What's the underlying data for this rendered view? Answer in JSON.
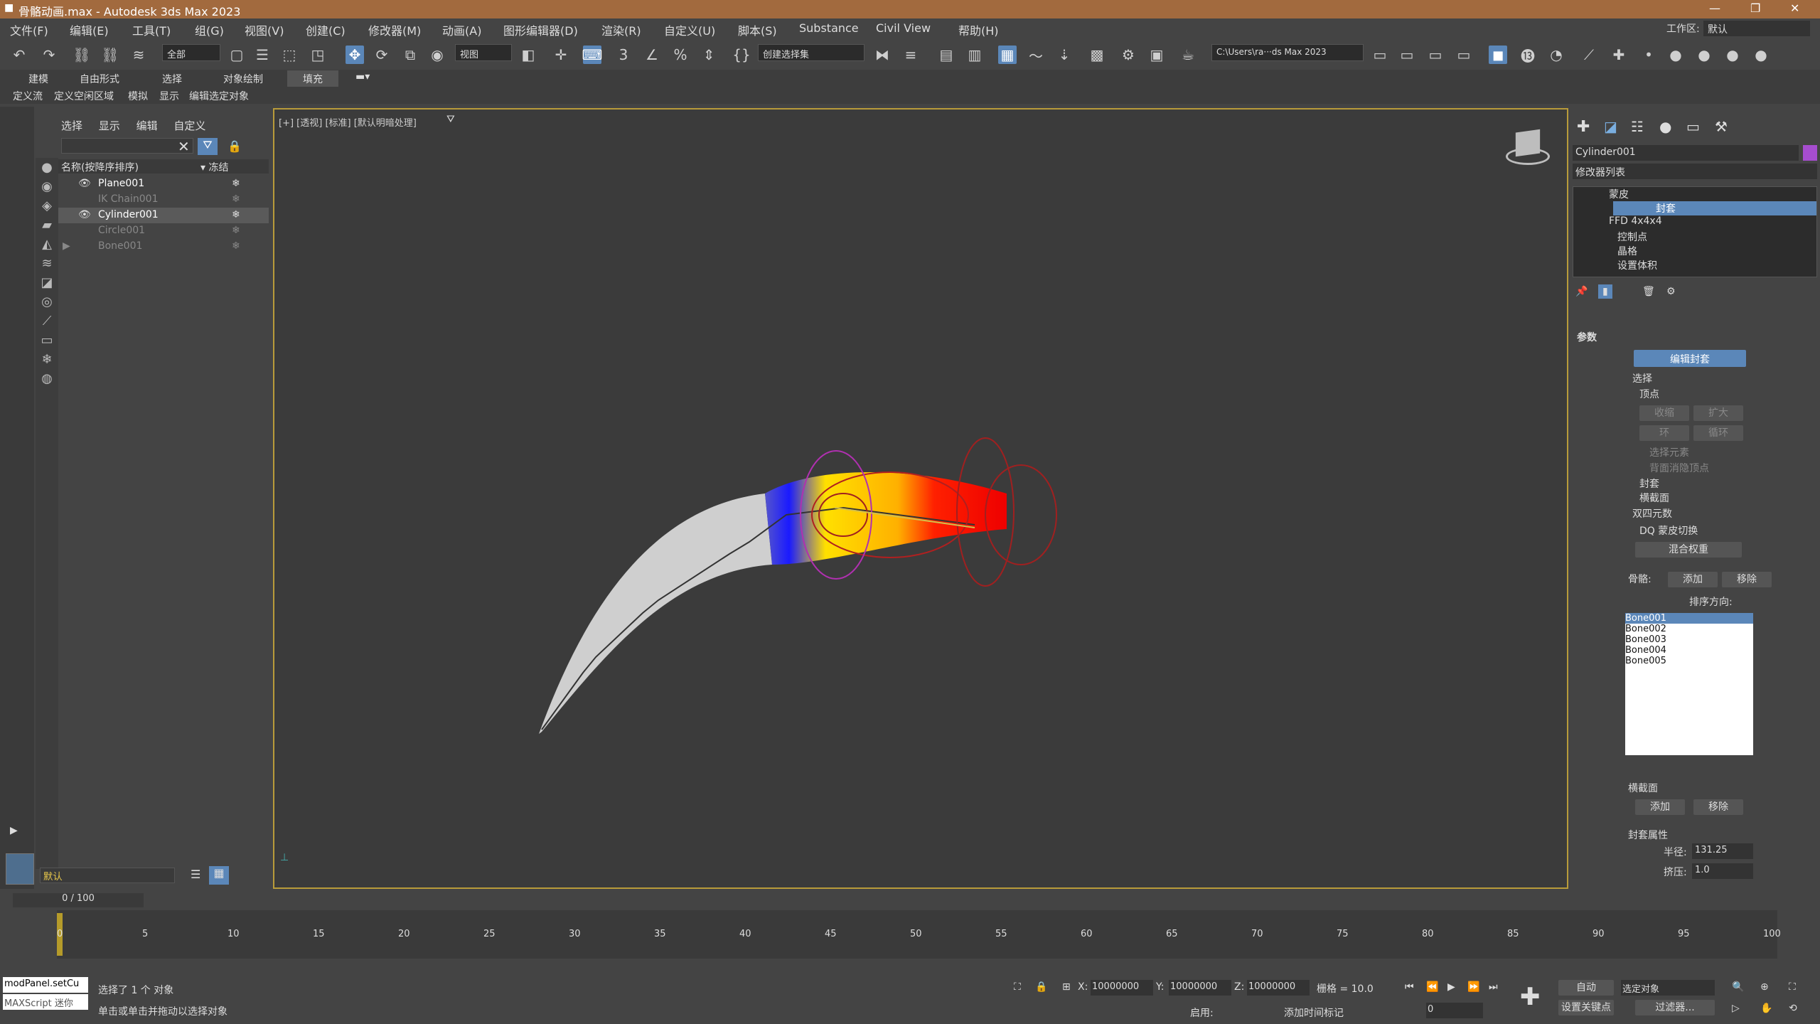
{
  "titlebar": {
    "title": "骨骼动画.max - Autodesk 3ds Max 2023",
    "workspace_label": "工作区:",
    "workspace_value": "默认"
  },
  "menu": [
    "文件(F)",
    "编辑(E)",
    "工具(T)",
    "组(G)",
    "视图(V)",
    "创建(C)",
    "修改器(M)",
    "动画(A)",
    "图形编辑器(D)",
    "渲染(R)",
    "自定义(U)",
    "脚本(S)",
    "Substance",
    "Civil View",
    "帮助(H)"
  ],
  "toolbar": {
    "filter_value": "全部",
    "view_value": "视图",
    "selection_set": "创建选择集",
    "path_value": "C:\\Users\\ra···ds Max 2023"
  },
  "ribbon_tabs": [
    "建模",
    "自由形式",
    "选择",
    "对象绘制",
    "填充"
  ],
  "ribbon2_items": [
    "定义流",
    "定义空闲区域",
    "模拟",
    "显示",
    "编辑选定对象"
  ],
  "scene_explorer": {
    "tabs": [
      "选择",
      "显示",
      "编辑",
      "自定义"
    ],
    "col_name": "名称(按降序排序)",
    "col_frozen": "▾ 冻结",
    "items": [
      "Plane001",
      "IK Chain001",
      "Cylinder001",
      "Circle001",
      "Bone001"
    ]
  },
  "viewport": {
    "label": "[+] [透视] [标准] [默认明暗处理]"
  },
  "cmd": {
    "object_name": "Cylinder001",
    "modlist_label": "修改器列表",
    "stack": [
      "蒙皮",
      "封套",
      "FFD 4x4x4",
      "控制点",
      "晶格",
      "设置体积"
    ],
    "rollout": "参数",
    "edit_env": "编辑封套",
    "select": "选择",
    "vertex": "顶点",
    "shrink": "收缩",
    "grow": "扩大",
    "ring": "环",
    "loop": "循环",
    "select_elem": "选择元素",
    "backface": "背面消隐顶点",
    "envelopes": "封套",
    "cross": "横截面",
    "dq": "双四元数",
    "dq_toggle": "DQ 蒙皮切换",
    "blend": "混合权重",
    "bones_label": "骨骼:",
    "add": "添加",
    "remove": "移除",
    "sort": "排序方向:",
    "bones": [
      "Bone001",
      "Bone002",
      "Bone003",
      "Bone004",
      "Bone005"
    ],
    "cross_label": "横截面",
    "env_props": "封套属性",
    "radius_label": "半径:",
    "radius": "131.25",
    "squash_label": "挤压:",
    "squash": "1.0"
  },
  "timeline": {
    "frame": "0 / 100",
    "ticks": [
      "0",
      "5",
      "10",
      "15",
      "20",
      "25",
      "30",
      "35",
      "40",
      "45",
      "50",
      "55",
      "60",
      "65",
      "70",
      "75",
      "80",
      "85",
      "90",
      "95",
      "100"
    ]
  },
  "status": {
    "script": "modPanel.setCu",
    "listener": "MAXScript 迷你",
    "selected": "选择了 1 个 对象",
    "hint": "单击或单击并拖动以选择对象",
    "x_label": "X:",
    "x": "10000000",
    "y_label": "Y:",
    "y": "10000000",
    "z_label": "Z:",
    "z": "10000000",
    "grid": "栅格 = 10.0",
    "enable": "启用:",
    "add_time": "添加时间标记",
    "auto": "自动",
    "set_key": "设置关键点",
    "sel_obj": "选定对象",
    "filters": "过滤器...",
    "frame": "0"
  },
  "layer": {
    "name": "默认"
  }
}
